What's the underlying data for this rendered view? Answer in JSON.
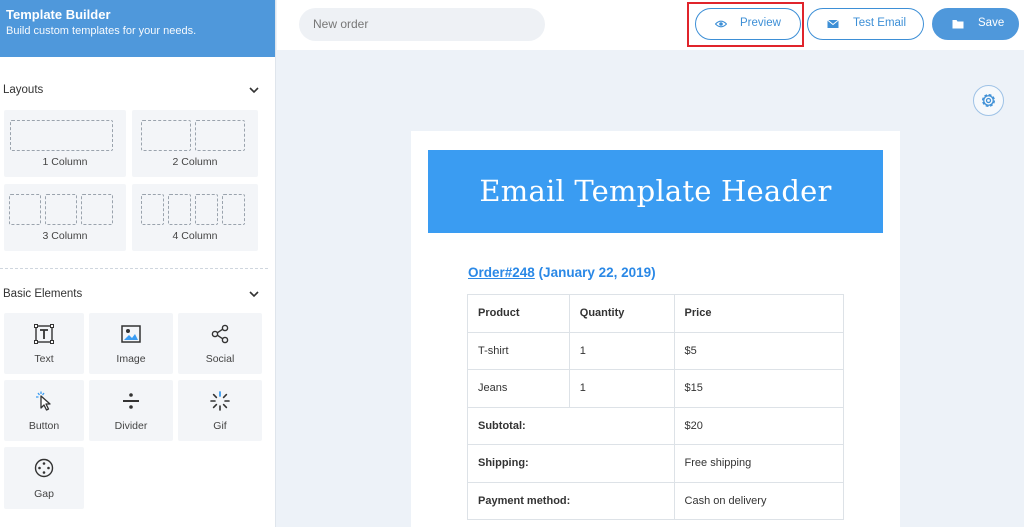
{
  "sidebar": {
    "title": "Template Builder",
    "subtitle": "Build custom templates for your needs.",
    "layouts": {
      "heading": "Layouts",
      "items": [
        {
          "label": "1 Column"
        },
        {
          "label": "2 Column"
        },
        {
          "label": "3 Column"
        },
        {
          "label": "4 Column"
        }
      ]
    },
    "basic_elements": {
      "heading": "Basic Elements",
      "items": [
        {
          "label": "Text",
          "icon": "text-icon"
        },
        {
          "label": "Image",
          "icon": "image-icon"
        },
        {
          "label": "Social",
          "icon": "share-icon"
        },
        {
          "label": "Button",
          "icon": "cursor-click-icon"
        },
        {
          "label": "Divider",
          "icon": "divider-icon"
        },
        {
          "label": "Gif",
          "icon": "loader-icon"
        },
        {
          "label": "Gap",
          "icon": "gap-icon"
        }
      ]
    }
  },
  "topbar": {
    "search_placeholder": "New order",
    "preview_label": "Preview",
    "test_email_label": "Test Email",
    "save_label": "Save"
  },
  "colors": {
    "accent": "#4f98db",
    "header_banner": "#3a9cf2",
    "link": "#2a88e6",
    "highlight": "#e0242b"
  },
  "email": {
    "header_title": "Email Template Header",
    "order_link": "Order#248",
    "order_date": "(January 22, 2019)",
    "table": {
      "headers": [
        "Product",
        "Quantity",
        "Price"
      ],
      "rows": [
        [
          "T-shirt",
          "1",
          "$5"
        ],
        [
          "Jeans",
          "1",
          "$15"
        ]
      ],
      "totals": [
        [
          "Subtotal:",
          "$20"
        ],
        [
          "Shipping:",
          "Free shipping"
        ],
        [
          "Payment method:",
          "Cash on delivery"
        ]
      ]
    }
  }
}
